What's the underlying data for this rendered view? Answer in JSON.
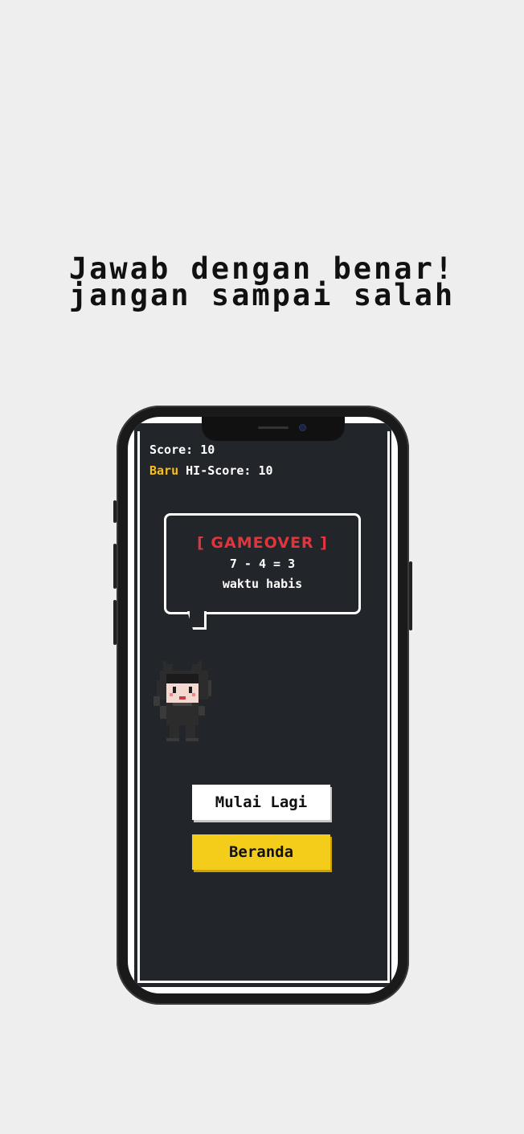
{
  "headline": {
    "line1": "Jawab dengan benar!",
    "line2": "jangan sampai salah"
  },
  "game": {
    "score_label": "Score: 10",
    "hiscore_new_label": "Baru",
    "hiscore_label": "HI-Score: 10",
    "bubble": {
      "title": "[ GAMEOVER ]",
      "equation": "7 - 4 = 3",
      "reason": "waktu habis"
    },
    "buttons": {
      "restart": "Mulai Lagi",
      "home": "Beranda"
    }
  },
  "colors": {
    "background": "#eeeeee",
    "screen": "#22252a",
    "accent_yellow": "#f4cc1a",
    "gameover_red": "#e0353d",
    "new_badge": "#f5c01a"
  },
  "icons": {
    "character": "pixel-cat-hood-character-icon"
  }
}
